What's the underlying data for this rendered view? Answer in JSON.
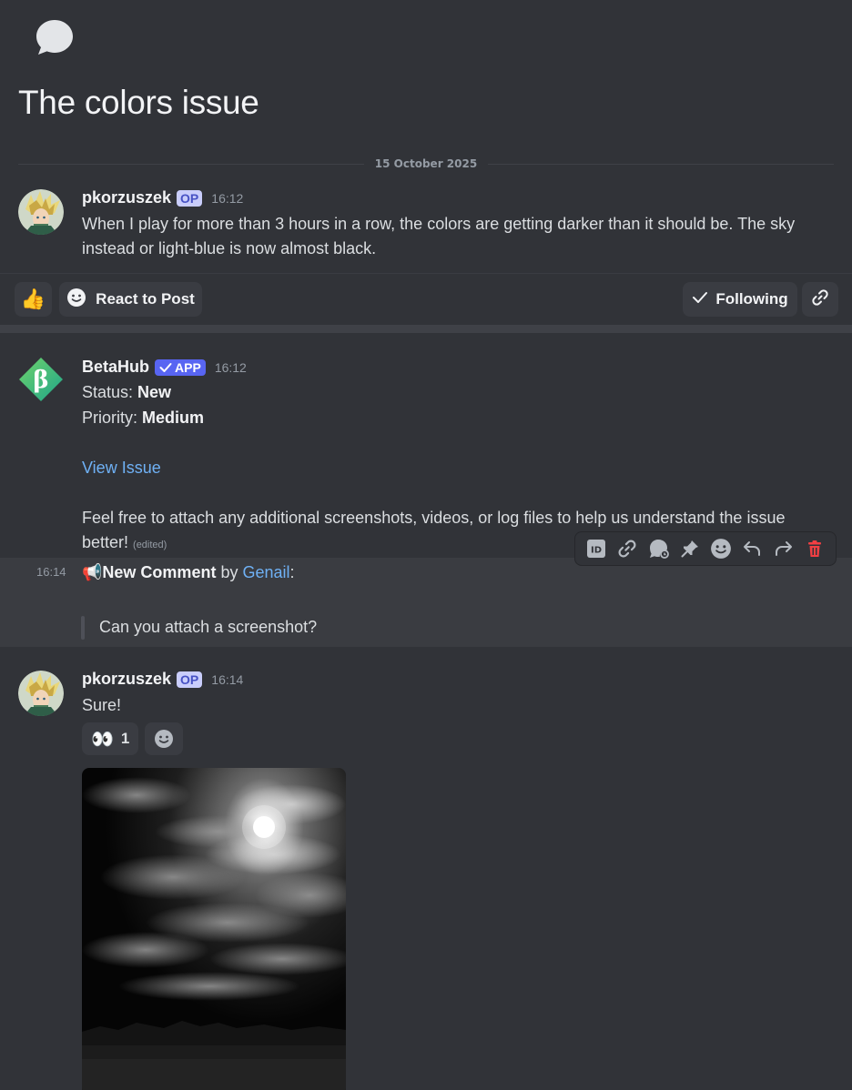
{
  "thread": {
    "title": "The colors issue",
    "date_divider": "15 October 2025"
  },
  "post": {
    "author": "pkorzuszek",
    "badge": "OP",
    "time": "16:12",
    "text": "When I play for more than 3 hours in a row, the colors are getting darker than it should be. The sky instead or light-blue is now almost black."
  },
  "post_actions": {
    "reaction_emoji": "👍",
    "react_label": "React to Post",
    "following_label": "Following"
  },
  "bot_message": {
    "author": "BetaHub",
    "badge": "APP",
    "time": "16:12",
    "status_label": "Status: ",
    "status_value": "New",
    "priority_label": "Priority: ",
    "priority_value": "Medium",
    "view_link": "View Issue",
    "help_text": "Feel free to attach any additional screenshots, videos, or log files to help us understand the issue better! ",
    "edited": "(edited)"
  },
  "comment_message": {
    "time": "16:14",
    "emoji": "📢",
    "title": "New Comment",
    "by": " by ",
    "user": "Genail",
    "colon": ":",
    "quote": "Can you attach a screenshot?"
  },
  "reply": {
    "author": "pkorzuszek",
    "badge": "OP",
    "time": "16:14",
    "text": "Sure!",
    "reaction_emoji": "👀",
    "reaction_count": "1"
  },
  "toolbar_icons": [
    "id-icon",
    "link-icon",
    "thread-icon",
    "pin-icon",
    "emoji-icon",
    "reply-icon",
    "forward-icon",
    "delete-icon"
  ],
  "colors": {
    "background": "#313338",
    "accent": "#5865f2",
    "link": "#6fb1f5",
    "danger": "#f23f43"
  }
}
